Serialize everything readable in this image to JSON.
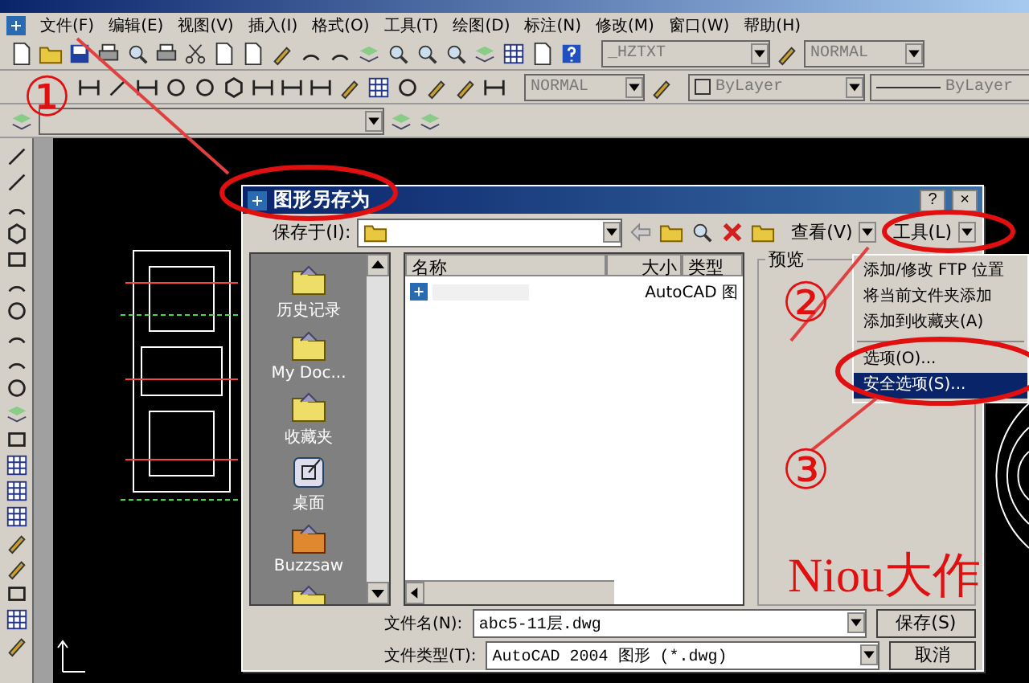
{
  "menu": [
    "文件(F)",
    "编辑(E)",
    "视图(V)",
    "插入(I)",
    "格式(O)",
    "工具(T)",
    "绘图(D)",
    "标注(N)",
    "修改(M)",
    "窗口(W)",
    "帮助(H)"
  ],
  "toolbars": {
    "text_style": "_HZTXT",
    "dim_style": "NORMAL",
    "plot_style": "NORMAL",
    "color_control": "ByLayer",
    "linetype": "ByLayer"
  },
  "dialog": {
    "title": "图形另存为",
    "help_button": "?",
    "close_button": "×",
    "save_in_label": "保存于(I):",
    "views_label": "查看(V)",
    "tools_label": "工具(L)",
    "places": [
      {
        "label": "历史记录",
        "kind": "folder"
      },
      {
        "label": "My Doc...",
        "kind": "folder"
      },
      {
        "label": "收藏夹",
        "kind": "folder"
      },
      {
        "label": "桌面",
        "kind": "desktop"
      },
      {
        "label": "Buzzsaw",
        "kind": "orange"
      },
      {
        "kind": "folder"
      }
    ],
    "columns": [
      "名称",
      "大小",
      "类型"
    ],
    "files": [
      {
        "type": "AutoCAD 图"
      }
    ],
    "preview_label": "预览",
    "tools_menu": [
      {
        "kind": "item",
        "label": "添加/修改 FTP 位置",
        "selected": false
      },
      {
        "kind": "item",
        "label": "将当前文件夹添加",
        "selected": false
      },
      {
        "kind": "item",
        "label": "添加到收藏夹(A)",
        "selected": false
      },
      {
        "kind": "separator"
      },
      {
        "kind": "item",
        "label": "选项(O)...",
        "selected": false
      },
      {
        "kind": "item",
        "label": "安全选项(S)...",
        "selected": true
      }
    ],
    "file_name_label": "文件名(N):",
    "file_name": "abc5-11层.dwg",
    "file_type_label": "文件类型(T):",
    "file_type": "AutoCAD 2004 图形 (*.dwg)",
    "save_button": "保存(S)",
    "cancel_button": "取消"
  },
  "annotations": {
    "markers": [
      "①",
      "②",
      "③"
    ],
    "signature": "Niou大作"
  }
}
